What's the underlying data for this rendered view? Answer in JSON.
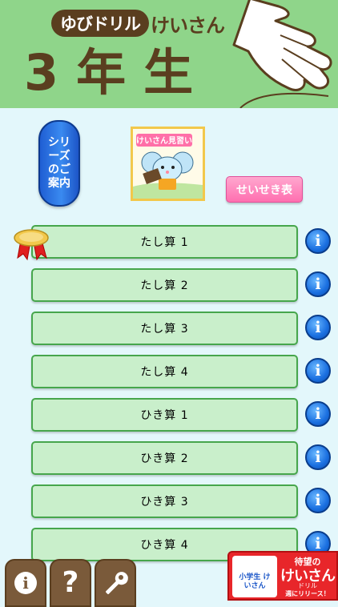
{
  "header": {
    "brand": "ゆびドリル",
    "subject": "けいさん",
    "grade": "3年生"
  },
  "series_button": {
    "label": "シリーズのご案内"
  },
  "mascot": {
    "banner_text": "けいさん見習い"
  },
  "score_button": {
    "label": "せいせき表"
  },
  "lessons": [
    {
      "label": "たし算 1",
      "medal": true
    },
    {
      "label": "たし算 2"
    },
    {
      "label": "たし算 3"
    },
    {
      "label": "たし算 4"
    },
    {
      "label": "ひき算 1"
    },
    {
      "label": "ひき算 2"
    },
    {
      "label": "ひき算 3"
    },
    {
      "label": "ひき算 4"
    }
  ],
  "info_glyph": "i",
  "toolbar": {
    "about_glyph": "i",
    "help_glyph": "?",
    "settings_icon": "wrench-icon"
  },
  "ad": {
    "line1": "待望の",
    "line2": "けいさん",
    "line3": "ドリル",
    "line4": "週にリリース！",
    "thumb_text": "小学生 けいさん"
  },
  "colors": {
    "header": "#8fd58a",
    "background": "#e3f7fb",
    "row_fill": "#c9efcb",
    "row_border": "#46a64c",
    "accent_brown": "#5a3e1f",
    "score_pink": "#ff6fb0",
    "ad_red": "#e8262a"
  }
}
